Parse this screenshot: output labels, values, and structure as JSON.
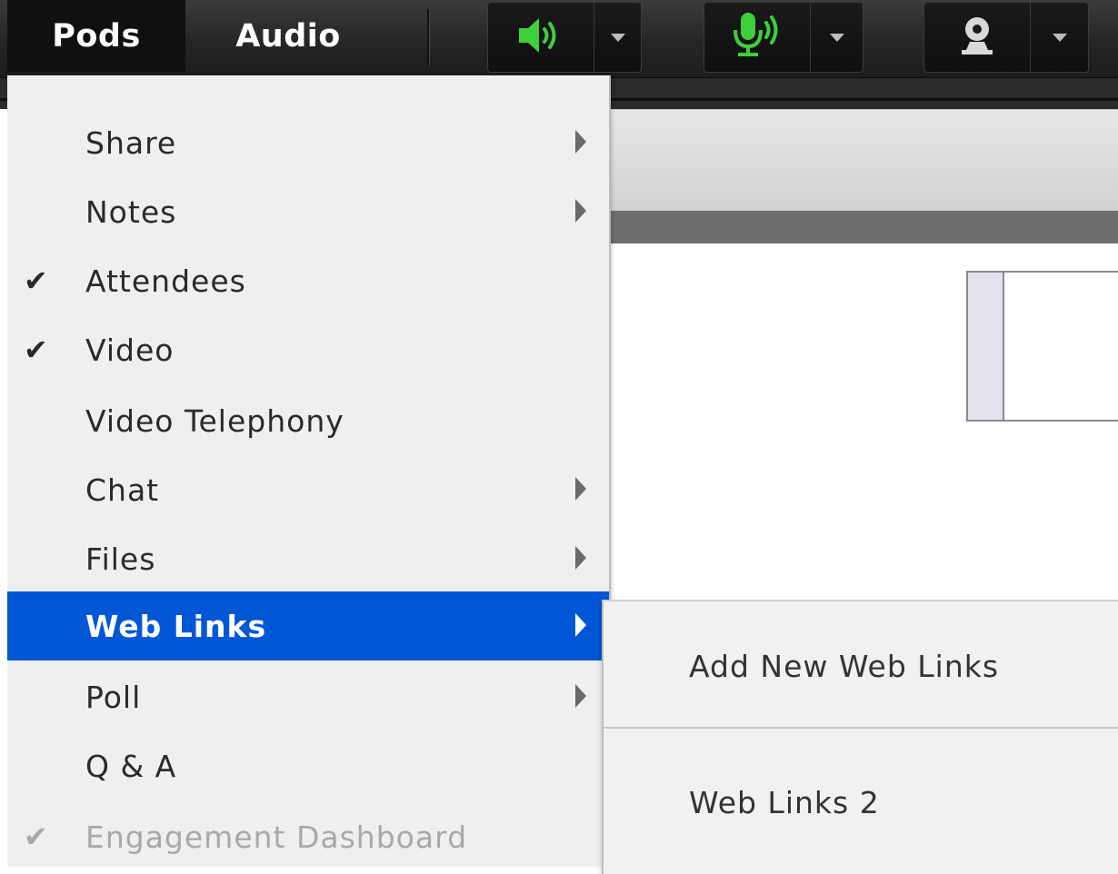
{
  "menubar": {
    "menus": [
      {
        "label": "Pods",
        "active": true
      },
      {
        "label": "Audio",
        "active": false
      }
    ],
    "toolbar": [
      {
        "name": "speaker",
        "icon": "speaker-icon",
        "color": "#3fcf3a"
      },
      {
        "name": "microphone",
        "icon": "microphone-icon",
        "color": "#3fcf3a"
      },
      {
        "name": "webcam",
        "icon": "webcam-icon",
        "color": "#d9d9d9"
      }
    ]
  },
  "pods_menu": {
    "highlight_color": "#0057d6",
    "items": [
      {
        "label": "Share",
        "checked": false,
        "submenu": true,
        "disabled": false
      },
      {
        "label": "Notes",
        "checked": false,
        "submenu": true,
        "disabled": false
      },
      {
        "label": "Attendees",
        "checked": true,
        "submenu": false,
        "disabled": false
      },
      {
        "label": "Video",
        "checked": true,
        "submenu": false,
        "disabled": false
      },
      {
        "label": "Video Telephony",
        "checked": false,
        "submenu": false,
        "disabled": false
      },
      {
        "label": "Chat",
        "checked": false,
        "submenu": true,
        "disabled": false
      },
      {
        "label": "Files",
        "checked": false,
        "submenu": true,
        "disabled": false
      },
      {
        "label": "Web Links",
        "checked": false,
        "submenu": true,
        "disabled": false,
        "highlighted": true
      },
      {
        "label": "Poll",
        "checked": false,
        "submenu": true,
        "disabled": false
      },
      {
        "label": "Q & A",
        "checked": false,
        "submenu": false,
        "disabled": false
      },
      {
        "label": "Engagement Dashboard",
        "checked": true,
        "submenu": false,
        "disabled": true
      }
    ],
    "check_glyph": "✔"
  },
  "web_links_submenu": {
    "items": [
      {
        "label": "Add New Web Links"
      },
      {
        "label": "Web Links 2"
      }
    ]
  }
}
